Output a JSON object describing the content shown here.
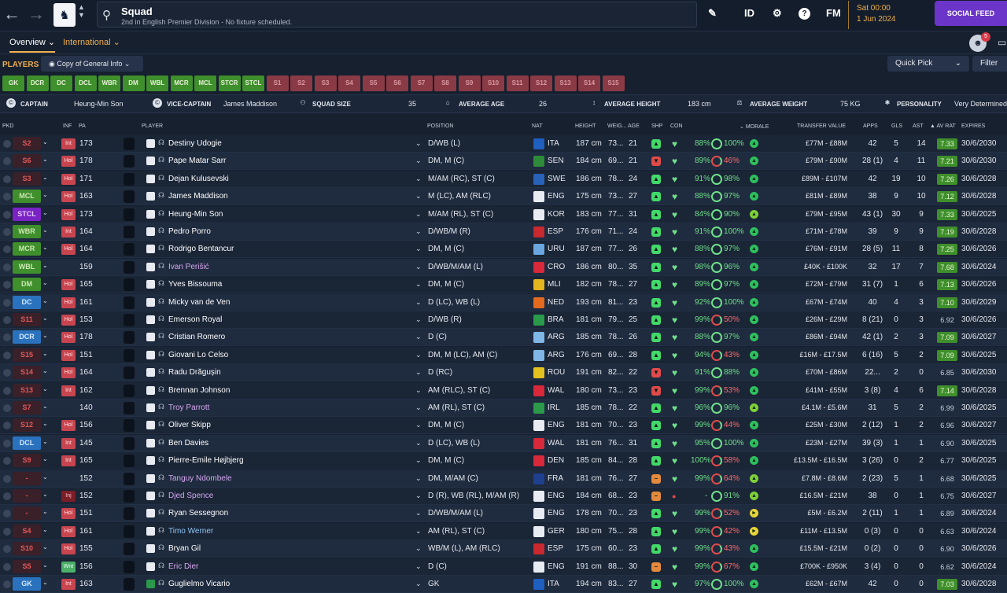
{
  "topbar": {
    "back": "←",
    "forward": "→",
    "title": "Squad",
    "subtitle": "2nd in English Premier Division - No fixture scheduled.",
    "icons": [
      "pencil-icon",
      "id-icon",
      "badge-icon",
      "help-icon",
      "fm-icon"
    ],
    "id_label": "ID",
    "help_label": "?",
    "fm_label": "FM",
    "time": "Sat 00:00",
    "date": "1 Jun 2024",
    "social_feed": "SOCIAL FEED"
  },
  "subnav": {
    "overview": "Overview",
    "international": "International",
    "notifications": "5"
  },
  "players_bar": {
    "label": "PLAYERS",
    "view": "Copy of General Info",
    "quick_pick": "Quick Pick",
    "filter": "Filter"
  },
  "positions": [
    {
      "label": "GK",
      "on": true
    },
    {
      "label": "DCR",
      "on": true
    },
    {
      "label": "DC",
      "on": true
    },
    {
      "label": "DCL",
      "on": true
    },
    {
      "label": "WBR",
      "on": true
    },
    {
      "label": "DM",
      "on": true
    },
    {
      "label": "WBL",
      "on": true
    },
    {
      "label": "MCR",
      "on": true
    },
    {
      "label": "MCL",
      "on": true
    },
    {
      "label": "STCR",
      "on": true
    },
    {
      "label": "STCL",
      "on": true
    },
    {
      "label": "S1",
      "on": false
    },
    {
      "label": "S2",
      "on": false
    },
    {
      "label": "S3",
      "on": false
    },
    {
      "label": "S4",
      "on": false
    },
    {
      "label": "S5",
      "on": false
    },
    {
      "label": "S6",
      "on": false
    },
    {
      "label": "S7",
      "on": false
    },
    {
      "label": "S8",
      "on": false
    },
    {
      "label": "S9",
      "on": false
    },
    {
      "label": "S10",
      "on": false
    },
    {
      "label": "S11",
      "on": false
    },
    {
      "label": "S12",
      "on": false
    },
    {
      "label": "S13",
      "on": false
    },
    {
      "label": "S14",
      "on": false
    },
    {
      "label": "S15",
      "on": false
    }
  ],
  "summary": {
    "captain_label": "CAPTAIN",
    "captain": "Heung-Min Son",
    "vice_label": "VICE-CAPTAIN",
    "vice": "James Maddison",
    "size_label": "SQUAD SIZE",
    "size": "35",
    "age_label": "AVERAGE AGE",
    "age": "26",
    "height_label": "AVERAGE HEIGHT",
    "height": "183 cm",
    "weight_label": "AVERAGE WEIGHT",
    "weight": "75 KG",
    "personality_label": "PERSONALITY",
    "personality": "Very Determined"
  },
  "headers": {
    "pkd": "PKD",
    "inf": "INF",
    "pa": "PA",
    "player": "PLAYER",
    "position": "POSITION",
    "nat": "NAT",
    "height": "HEIGHT",
    "weight": "WEIG...",
    "age": "AGE",
    "shp": "SHP",
    "con": "CON",
    "morale": "MORALE",
    "value": "TRANSFER VALUE",
    "apps": "APPS",
    "gls": "GLS",
    "ast": "AST",
    "avrat": "AV RAT",
    "expires": "EXPIRES"
  },
  "players": [
    {
      "pkd": "S2",
      "pkd_style": "red",
      "inf": "Int",
      "inf_style": "red",
      "pa": "173",
      "name": "Destiny Udogie",
      "name_color": "#ffffff",
      "position": "D/WB (L)",
      "nat": "ITA",
      "flag": "#1f5fbf",
      "height": "187 cm",
      "weight": "73...",
      "age": "21",
      "shp": "up",
      "con": "88%",
      "cond": "100%",
      "cond_low": false,
      "morale": "hi",
      "value": "£77M - £88M",
      "apps": "42",
      "gls": "5",
      "ast": "14",
      "avrat": "7.33",
      "avrat_hi": true,
      "expires": "30/6/2030",
      "shirt": "white"
    },
    {
      "pkd": "S6",
      "pkd_style": "red",
      "inf": "Hol",
      "inf_style": "red",
      "pa": "178",
      "name": "Pape Matar Sarr",
      "name_color": "#ffffff",
      "position": "DM, M (C)",
      "nat": "SEN",
      "flag": "#2e8b3a",
      "height": "184 cm",
      "weight": "69...",
      "age": "21",
      "shp": "down",
      "con": "89%",
      "cond": "46%",
      "cond_low": true,
      "morale": "hi",
      "value": "£79M - £90M",
      "apps": "28 (1)",
      "gls": "4",
      "ast": "11",
      "avrat": "7.21",
      "avrat_hi": true,
      "expires": "30/6/2030",
      "shirt": "white"
    },
    {
      "pkd": "S3",
      "pkd_style": "red",
      "inf": "Hol",
      "inf_style": "red",
      "pa": "171",
      "name": "Dejan Kulusevski",
      "name_color": "#ffffff",
      "position": "M/AM (RC), ST (C)",
      "nat": "SWE",
      "flag": "#2a62b8",
      "height": "186 cm",
      "weight": "78...",
      "age": "24",
      "shp": "up",
      "con": "91%",
      "cond": "98%",
      "cond_low": false,
      "morale": "hi",
      "value": "£89M - £107M",
      "apps": "42",
      "gls": "19",
      "ast": "10",
      "avrat": "7.26",
      "avrat_hi": true,
      "expires": "30/6/2028",
      "shirt": "white"
    },
    {
      "pkd": "MCL",
      "pkd_style": "green",
      "inf": "Hol",
      "inf_style": "red",
      "pa": "163",
      "name": "James Maddison",
      "name_color": "#ffffff",
      "position": "M (LC), AM (RLC)",
      "nat": "ENG",
      "flag": "#e8ecf2",
      "height": "175 cm",
      "weight": "73...",
      "age": "27",
      "shp": "up",
      "con": "88%",
      "cond": "97%",
      "cond_low": false,
      "morale": "hi",
      "value": "£81M - £89M",
      "apps": "38",
      "gls": "9",
      "ast": "10",
      "avrat": "7.12",
      "avrat_hi": true,
      "expires": "30/6/2028",
      "shirt": "white"
    },
    {
      "pkd": "STCL",
      "pkd_style": "purple",
      "inf": "Hol",
      "inf_style": "red",
      "pa": "173",
      "name": "Heung-Min Son",
      "name_color": "#ffffff",
      "position": "M/AM (RL), ST (C)",
      "nat": "KOR",
      "flag": "#e8ecf2",
      "height": "183 cm",
      "weight": "77...",
      "age": "31",
      "shp": "up",
      "con": "84%",
      "cond": "90%",
      "cond_low": false,
      "morale": "ok",
      "value": "£79M - £95M",
      "apps": "43 (1)",
      "gls": "30",
      "ast": "9",
      "avrat": "7.33",
      "avrat_hi": true,
      "expires": "30/6/2025",
      "shirt": "white"
    },
    {
      "pkd": "WBR",
      "pkd_style": "green",
      "inf": "Int",
      "inf_style": "red",
      "pa": "164",
      "name": "Pedro Porro",
      "name_color": "#ffffff",
      "position": "D/WB/M (R)",
      "nat": "ESP",
      "flag": "#c8282e",
      "height": "176 cm",
      "weight": "71...",
      "age": "24",
      "shp": "up",
      "con": "91%",
      "cond": "100%",
      "cond_low": false,
      "morale": "hi",
      "value": "£71M - £78M",
      "apps": "39",
      "gls": "9",
      "ast": "9",
      "avrat": "7.19",
      "avrat_hi": true,
      "expires": "30/6/2028",
      "shirt": "white"
    },
    {
      "pkd": "MCR",
      "pkd_style": "green",
      "inf": "Hol",
      "inf_style": "red",
      "pa": "164",
      "name": "Rodrigo Bentancur",
      "name_color": "#ffffff",
      "position": "DM, M (C)",
      "nat": "URU",
      "flag": "#6aa6e0",
      "height": "187 cm",
      "weight": "77...",
      "age": "26",
      "shp": "up",
      "con": "88%",
      "cond": "97%",
      "cond_low": false,
      "morale": "hi",
      "value": "£76M - £91M",
      "apps": "28 (5)",
      "gls": "11",
      "ast": "8",
      "avrat": "7.25",
      "avrat_hi": true,
      "expires": "30/6/2026",
      "shirt": "white"
    },
    {
      "pkd": "WBL",
      "pkd_style": "green",
      "inf": "",
      "inf_style": "none",
      "pa": "159",
      "name": "Ivan Perišić",
      "name_color": "#d6a8f0",
      "position": "D/WB/M/AM (L)",
      "nat": "CRO",
      "flag": "#d8283a",
      "height": "186 cm",
      "weight": "80...",
      "age": "35",
      "shp": "up",
      "con": "98%",
      "cond": "96%",
      "cond_low": false,
      "morale": "hi",
      "value": "£40K - £100K",
      "apps": "32",
      "gls": "17",
      "ast": "7",
      "avrat": "7.68",
      "avrat_hi": true,
      "expires": "30/6/2024",
      "shirt": "white"
    },
    {
      "pkd": "DM",
      "pkd_style": "green",
      "inf": "Hol",
      "inf_style": "red",
      "pa": "165",
      "name": "Yves Bissouma",
      "name_color": "#ffffff",
      "position": "DM, M (C)",
      "nat": "MLI",
      "flag": "#e3b51f",
      "height": "182 cm",
      "weight": "78...",
      "age": "27",
      "shp": "up",
      "con": "89%",
      "cond": "97%",
      "cond_low": false,
      "morale": "hi",
      "value": "£72M - £79M",
      "apps": "31 (7)",
      "gls": "1",
      "ast": "6",
      "avrat": "7.13",
      "avrat_hi": true,
      "expires": "30/6/2026",
      "shirt": "white"
    },
    {
      "pkd": "DC",
      "pkd_style": "blue",
      "inf": "Hol",
      "inf_style": "red",
      "pa": "161",
      "name": "Micky van de Ven",
      "name_color": "#ffffff",
      "position": "D (LC), WB (L)",
      "nat": "NED",
      "flag": "#e36a1f",
      "height": "193 cm",
      "weight": "81...",
      "age": "23",
      "shp": "up",
      "con": "92%",
      "cond": "100%",
      "cond_low": false,
      "morale": "hi",
      "value": "£67M - £74M",
      "apps": "40",
      "gls": "4",
      "ast": "3",
      "avrat": "7.10",
      "avrat_hi": true,
      "expires": "30/6/2029",
      "shirt": "white"
    },
    {
      "pkd": "S11",
      "pkd_style": "red",
      "inf": "Hol",
      "inf_style": "red",
      "pa": "153",
      "name": "Emerson Royal",
      "name_color": "#ffffff",
      "position": "D/WB (R)",
      "nat": "BRA",
      "flag": "#2a9a4a",
      "height": "181 cm",
      "weight": "79...",
      "age": "25",
      "shp": "up",
      "con": "99%",
      "cond": "50%",
      "cond_low": true,
      "morale": "hi",
      "value": "£26M - £29M",
      "apps": "8 (21)",
      "gls": "0",
      "ast": "3",
      "avrat": "6.92",
      "avrat_hi": false,
      "expires": "30/6/2026",
      "shirt": "white"
    },
    {
      "pkd": "DCR",
      "pkd_style": "blue",
      "inf": "Hol",
      "inf_style": "red",
      "pa": "178",
      "name": "Cristian Romero",
      "name_color": "#ffffff",
      "position": "D (C)",
      "nat": "ARG",
      "flag": "#7fb8e6",
      "height": "185 cm",
      "weight": "78...",
      "age": "26",
      "shp": "up",
      "con": "88%",
      "cond": "97%",
      "cond_low": false,
      "morale": "hi",
      "value": "£86M - £94M",
      "apps": "42 (1)",
      "gls": "2",
      "ast": "3",
      "avrat": "7.09",
      "avrat_hi": true,
      "expires": "30/6/2027",
      "shirt": "white"
    },
    {
      "pkd": "S15",
      "pkd_style": "red",
      "inf": "Hol",
      "inf_style": "red",
      "pa": "151",
      "name": "Giovani Lo Celso",
      "name_color": "#ffffff",
      "position": "DM, M (LC), AM (C)",
      "nat": "ARG",
      "flag": "#7fb8e6",
      "height": "176 cm",
      "weight": "69...",
      "age": "28",
      "shp": "up",
      "con": "94%",
      "cond": "43%",
      "cond_low": true,
      "morale": "hi",
      "value": "£16M - £17.5M",
      "apps": "6 (16)",
      "gls": "5",
      "ast": "2",
      "avrat": "7.09",
      "avrat_hi": true,
      "expires": "30/6/2025",
      "shirt": "white"
    },
    {
      "pkd": "S14",
      "pkd_style": "red",
      "inf": "Hol",
      "inf_style": "red",
      "pa": "164",
      "name": "Radu Drăgușin",
      "name_color": "#ffffff",
      "position": "D (RC)",
      "nat": "ROU",
      "flag": "#e3c21f",
      "height": "191 cm",
      "weight": "82...",
      "age": "22",
      "shp": "down",
      "con": "91%",
      "cond": "88%",
      "cond_low": false,
      "morale": "hi",
      "value": "£70M - £86M",
      "apps": "22...",
      "gls": "2",
      "ast": "0",
      "avrat": "6.85",
      "avrat_hi": false,
      "expires": "30/6/2030",
      "shirt": "white"
    },
    {
      "pkd": "S13",
      "pkd_style": "red",
      "inf": "Int",
      "inf_style": "red",
      "pa": "162",
      "name": "Brennan Johnson",
      "name_color": "#ffffff",
      "position": "AM (RLC), ST (C)",
      "nat": "WAL",
      "flag": "#d8283a",
      "height": "180 cm",
      "weight": "73...",
      "age": "23",
      "shp": "down",
      "con": "99%",
      "cond": "53%",
      "cond_low": true,
      "morale": "hi",
      "value": "£41M - £55M",
      "apps": "3 (8)",
      "gls": "4",
      "ast": "6",
      "avrat": "7.14",
      "avrat_hi": true,
      "expires": "30/6/2028",
      "shirt": "white"
    },
    {
      "pkd": "S7",
      "pkd_style": "red",
      "inf": "",
      "inf_style": "none",
      "pa": "140",
      "name": "Troy Parrott",
      "name_color": "#d6a8f0",
      "position": "AM (RL), ST (C)",
      "nat": "IRL",
      "flag": "#2a9a4a",
      "height": "185 cm",
      "weight": "78...",
      "age": "22",
      "shp": "up",
      "con": "96%",
      "cond": "96%",
      "cond_low": false,
      "morale": "ok",
      "value": "£4.1M - £5.6M",
      "apps": "31",
      "gls": "5",
      "ast": "2",
      "avrat": "6.99",
      "avrat_hi": false,
      "expires": "30/6/2025",
      "shirt": "white"
    },
    {
      "pkd": "S12",
      "pkd_style": "red",
      "inf": "Hol",
      "inf_style": "red",
      "pa": "156",
      "name": "Oliver Skipp",
      "name_color": "#ffffff",
      "position": "DM, M (C)",
      "nat": "ENG",
      "flag": "#e8ecf2",
      "height": "181 cm",
      "weight": "70...",
      "age": "23",
      "shp": "up",
      "con": "99%",
      "cond": "44%",
      "cond_low": true,
      "morale": "hi",
      "value": "£25M - £30M",
      "apps": "2 (12)",
      "gls": "1",
      "ast": "2",
      "avrat": "6.96",
      "avrat_hi": false,
      "expires": "30/6/2027",
      "shirt": "white"
    },
    {
      "pkd": "DCL",
      "pkd_style": "blue",
      "inf": "Int",
      "inf_style": "red",
      "pa": "145",
      "name": "Ben Davies",
      "name_color": "#ffffff",
      "position": "D (LC), WB (L)",
      "nat": "WAL",
      "flag": "#d8283a",
      "height": "181 cm",
      "weight": "76...",
      "age": "31",
      "shp": "up",
      "con": "95%",
      "cond": "100%",
      "cond_low": false,
      "morale": "hi",
      "value": "£23M - £27M",
      "apps": "39 (3)",
      "gls": "1",
      "ast": "1",
      "avrat": "6.90",
      "avrat_hi": false,
      "expires": "30/6/2025",
      "shirt": "white"
    },
    {
      "pkd": "S9",
      "pkd_style": "red",
      "inf": "Int",
      "inf_style": "red",
      "pa": "165",
      "name": "Pierre-Emile Højbjerg",
      "name_color": "#ffffff",
      "position": "DM, M (C)",
      "nat": "DEN",
      "flag": "#d8283a",
      "height": "185 cm",
      "weight": "84...",
      "age": "28",
      "shp": "up",
      "con": "100%",
      "cond": "58%",
      "cond_low": true,
      "morale": "hi",
      "value": "£13.5M - £16.5M",
      "apps": "3 (26)",
      "gls": "0",
      "ast": "2",
      "avrat": "6.77",
      "avrat_hi": false,
      "expires": "30/6/2025",
      "shirt": "white"
    },
    {
      "pkd": "-",
      "pkd_style": "dash",
      "inf": "",
      "inf_style": "none",
      "pa": "152",
      "name": "Tanguy Ndombele",
      "name_color": "#d6a8f0",
      "position": "DM, M/AM (C)",
      "nat": "FRA",
      "flag": "#1f3f8f",
      "height": "181 cm",
      "weight": "76...",
      "age": "27",
      "shp": "mid",
      "con": "99%",
      "cond": "64%",
      "cond_low": true,
      "morale": "ok",
      "value": "£7.8M - £8.6M",
      "apps": "2 (23)",
      "gls": "5",
      "ast": "1",
      "avrat": "6.68",
      "avrat_hi": false,
      "expires": "30/6/2025",
      "shirt": "white"
    },
    {
      "pkd": "-",
      "pkd_style": "dash",
      "inf": "Inj",
      "inf_style": "dark",
      "pa": "152",
      "name": "Djed Spence",
      "name_color": "#d6a8f0",
      "position": "D (R), WB (RL), M/AM (R)",
      "nat": "ENG",
      "flag": "#e8ecf2",
      "height": "184 cm",
      "weight": "68...",
      "age": "23",
      "shp": "mid",
      "con": "-",
      "cond": "91%",
      "cond_low": false,
      "morale": "ok",
      "value": "£16.5M - £21M",
      "apps": "38",
      "gls": "0",
      "ast": "1",
      "avrat": "6.75",
      "avrat_hi": false,
      "expires": "30/6/2027",
      "shirt": "white"
    },
    {
      "pkd": "-",
      "pkd_style": "dash",
      "inf": "Hol",
      "inf_style": "red",
      "pa": "151",
      "name": "Ryan Sessegnon",
      "name_color": "#ffffff",
      "position": "D/WB/M/AM (L)",
      "nat": "ENG",
      "flag": "#e8ecf2",
      "height": "178 cm",
      "weight": "70...",
      "age": "23",
      "shp": "up",
      "con": "99%",
      "cond": "52%",
      "cond_low": true,
      "morale": "poor",
      "value": "£5M - £6.2M",
      "apps": "2 (11)",
      "gls": "1",
      "ast": "1",
      "avrat": "6.89",
      "avrat_hi": false,
      "expires": "30/6/2024",
      "shirt": "white"
    },
    {
      "pkd": "S4",
      "pkd_style": "red",
      "inf": "Hol",
      "inf_style": "red",
      "pa": "161",
      "name": "Timo Werner",
      "name_color": "#8ec4f0",
      "position": "AM (RL), ST (C)",
      "nat": "GER",
      "flag": "#e8ecf2",
      "height": "180 cm",
      "weight": "75...",
      "age": "28",
      "shp": "up",
      "con": "99%",
      "cond": "42%",
      "cond_low": true,
      "morale": "poor",
      "value": "£11M - £13.5M",
      "apps": "0 (3)",
      "gls": "0",
      "ast": "0",
      "avrat": "6.63",
      "avrat_hi": false,
      "expires": "30/6/2024",
      "shirt": "white"
    },
    {
      "pkd": "S10",
      "pkd_style": "red",
      "inf": "Hol",
      "inf_style": "red",
      "pa": "155",
      "name": "Bryan Gil",
      "name_color": "#ffffff",
      "position": "WB/M (L), AM (RLC)",
      "nat": "ESP",
      "flag": "#c8282e",
      "height": "175 cm",
      "weight": "60...",
      "age": "23",
      "shp": "up",
      "con": "99%",
      "cond": "43%",
      "cond_low": true,
      "morale": "hi",
      "value": "£15.5M - £21M",
      "apps": "0 (2)",
      "gls": "0",
      "ast": "0",
      "avrat": "6.90",
      "avrat_hi": false,
      "expires": "30/6/2026",
      "shirt": "white"
    },
    {
      "pkd": "S5",
      "pkd_style": "red",
      "inf": "Wnt",
      "inf_style": "green",
      "pa": "156",
      "name": "Eric Dier",
      "name_color": "#d6a8f0",
      "position": "D (C)",
      "nat": "ENG",
      "flag": "#e8ecf2",
      "height": "191 cm",
      "weight": "88...",
      "age": "30",
      "shp": "mid",
      "con": "99%",
      "cond": "67%",
      "cond_low": true,
      "morale": "hi",
      "value": "£700K - £950K",
      "apps": "3 (4)",
      "gls": "0",
      "ast": "0",
      "avrat": "6.62",
      "avrat_hi": false,
      "expires": "30/6/2024",
      "shirt": "white"
    },
    {
      "pkd": "GK",
      "pkd_style": "blue",
      "inf": "Int",
      "inf_style": "red",
      "pa": "163",
      "name": "Guglielmo Vicario",
      "name_color": "#ffffff",
      "position": "GK",
      "nat": "ITA",
      "flag": "#1f5fbf",
      "height": "194 cm",
      "weight": "83...",
      "age": "27",
      "shp": "up",
      "con": "97%",
      "cond": "100%",
      "cond_low": false,
      "morale": "hi",
      "value": "£62M - £67M",
      "apps": "42",
      "gls": "0",
      "ast": "0",
      "avrat": "7.03",
      "avrat_hi": true,
      "expires": "30/6/2028",
      "shirt": "green"
    }
  ]
}
